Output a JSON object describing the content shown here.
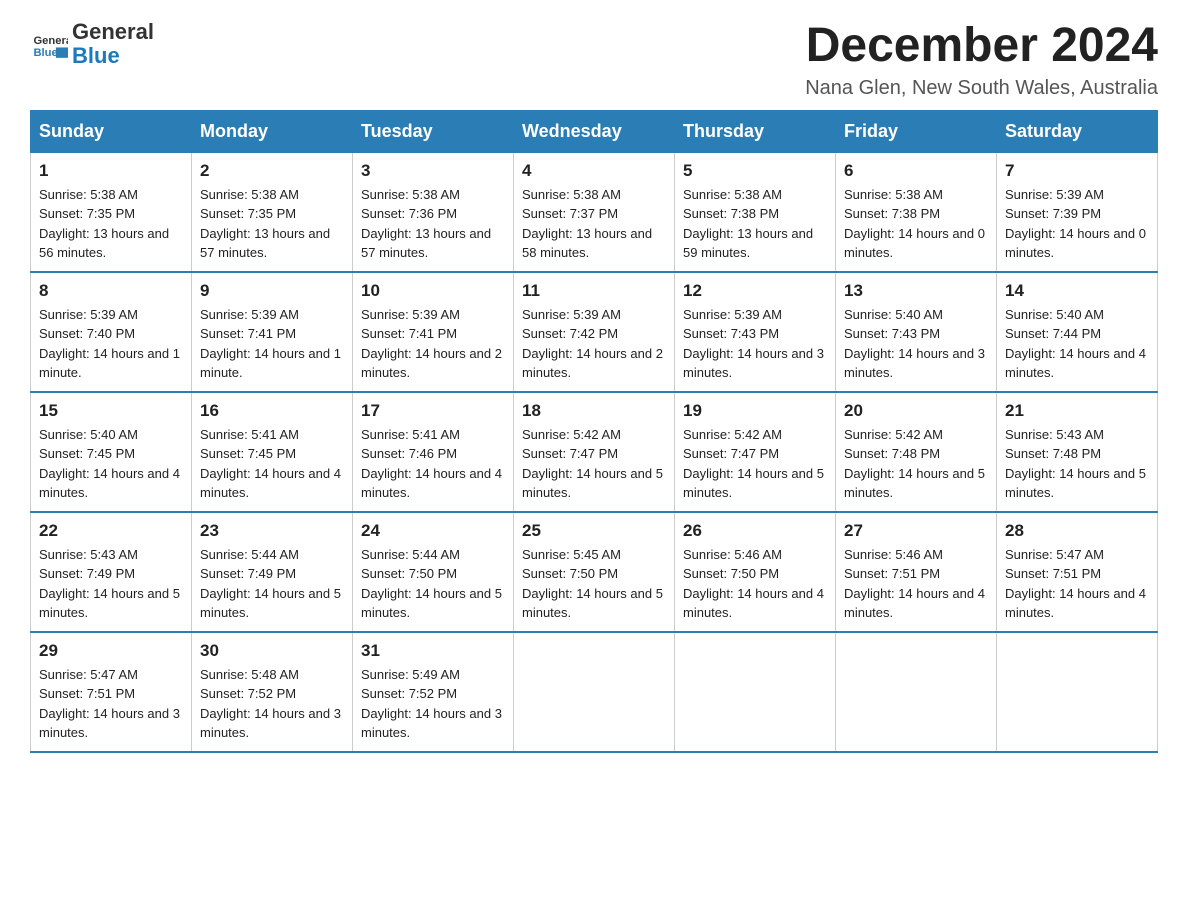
{
  "header": {
    "logo_line1": "General",
    "logo_line2": "Blue",
    "month_title": "December 2024",
    "location": "Nana Glen, New South Wales, Australia"
  },
  "days_of_week": [
    "Sunday",
    "Monday",
    "Tuesday",
    "Wednesday",
    "Thursday",
    "Friday",
    "Saturday"
  ],
  "weeks": [
    [
      {
        "day": "1",
        "sunrise": "5:38 AM",
        "sunset": "7:35 PM",
        "daylight": "13 hours and 56 minutes."
      },
      {
        "day": "2",
        "sunrise": "5:38 AM",
        "sunset": "7:35 PM",
        "daylight": "13 hours and 57 minutes."
      },
      {
        "day": "3",
        "sunrise": "5:38 AM",
        "sunset": "7:36 PM",
        "daylight": "13 hours and 57 minutes."
      },
      {
        "day": "4",
        "sunrise": "5:38 AM",
        "sunset": "7:37 PM",
        "daylight": "13 hours and 58 minutes."
      },
      {
        "day": "5",
        "sunrise": "5:38 AM",
        "sunset": "7:38 PM",
        "daylight": "13 hours and 59 minutes."
      },
      {
        "day": "6",
        "sunrise": "5:38 AM",
        "sunset": "7:38 PM",
        "daylight": "14 hours and 0 minutes."
      },
      {
        "day": "7",
        "sunrise": "5:39 AM",
        "sunset": "7:39 PM",
        "daylight": "14 hours and 0 minutes."
      }
    ],
    [
      {
        "day": "8",
        "sunrise": "5:39 AM",
        "sunset": "7:40 PM",
        "daylight": "14 hours and 1 minute."
      },
      {
        "day": "9",
        "sunrise": "5:39 AM",
        "sunset": "7:41 PM",
        "daylight": "14 hours and 1 minute."
      },
      {
        "day": "10",
        "sunrise": "5:39 AM",
        "sunset": "7:41 PM",
        "daylight": "14 hours and 2 minutes."
      },
      {
        "day": "11",
        "sunrise": "5:39 AM",
        "sunset": "7:42 PM",
        "daylight": "14 hours and 2 minutes."
      },
      {
        "day": "12",
        "sunrise": "5:39 AM",
        "sunset": "7:43 PM",
        "daylight": "14 hours and 3 minutes."
      },
      {
        "day": "13",
        "sunrise": "5:40 AM",
        "sunset": "7:43 PM",
        "daylight": "14 hours and 3 minutes."
      },
      {
        "day": "14",
        "sunrise": "5:40 AM",
        "sunset": "7:44 PM",
        "daylight": "14 hours and 4 minutes."
      }
    ],
    [
      {
        "day": "15",
        "sunrise": "5:40 AM",
        "sunset": "7:45 PM",
        "daylight": "14 hours and 4 minutes."
      },
      {
        "day": "16",
        "sunrise": "5:41 AM",
        "sunset": "7:45 PM",
        "daylight": "14 hours and 4 minutes."
      },
      {
        "day": "17",
        "sunrise": "5:41 AM",
        "sunset": "7:46 PM",
        "daylight": "14 hours and 4 minutes."
      },
      {
        "day": "18",
        "sunrise": "5:42 AM",
        "sunset": "7:47 PM",
        "daylight": "14 hours and 5 minutes."
      },
      {
        "day": "19",
        "sunrise": "5:42 AM",
        "sunset": "7:47 PM",
        "daylight": "14 hours and 5 minutes."
      },
      {
        "day": "20",
        "sunrise": "5:42 AM",
        "sunset": "7:48 PM",
        "daylight": "14 hours and 5 minutes."
      },
      {
        "day": "21",
        "sunrise": "5:43 AM",
        "sunset": "7:48 PM",
        "daylight": "14 hours and 5 minutes."
      }
    ],
    [
      {
        "day": "22",
        "sunrise": "5:43 AM",
        "sunset": "7:49 PM",
        "daylight": "14 hours and 5 minutes."
      },
      {
        "day": "23",
        "sunrise": "5:44 AM",
        "sunset": "7:49 PM",
        "daylight": "14 hours and 5 minutes."
      },
      {
        "day": "24",
        "sunrise": "5:44 AM",
        "sunset": "7:50 PM",
        "daylight": "14 hours and 5 minutes."
      },
      {
        "day": "25",
        "sunrise": "5:45 AM",
        "sunset": "7:50 PM",
        "daylight": "14 hours and 5 minutes."
      },
      {
        "day": "26",
        "sunrise": "5:46 AM",
        "sunset": "7:50 PM",
        "daylight": "14 hours and 4 minutes."
      },
      {
        "day": "27",
        "sunrise": "5:46 AM",
        "sunset": "7:51 PM",
        "daylight": "14 hours and 4 minutes."
      },
      {
        "day": "28",
        "sunrise": "5:47 AM",
        "sunset": "7:51 PM",
        "daylight": "14 hours and 4 minutes."
      }
    ],
    [
      {
        "day": "29",
        "sunrise": "5:47 AM",
        "sunset": "7:51 PM",
        "daylight": "14 hours and 3 minutes."
      },
      {
        "day": "30",
        "sunrise": "5:48 AM",
        "sunset": "7:52 PM",
        "daylight": "14 hours and 3 minutes."
      },
      {
        "day": "31",
        "sunrise": "5:49 AM",
        "sunset": "7:52 PM",
        "daylight": "14 hours and 3 minutes."
      },
      null,
      null,
      null,
      null
    ]
  ],
  "labels": {
    "sunrise": "Sunrise:",
    "sunset": "Sunset:",
    "daylight": "Daylight:"
  }
}
